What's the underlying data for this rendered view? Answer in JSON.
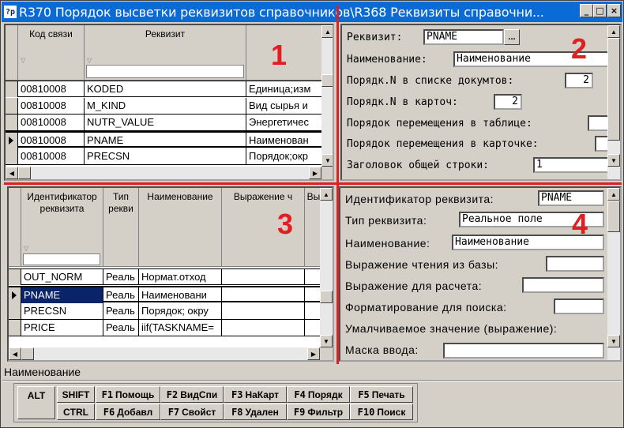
{
  "window": {
    "title": "R370 Порядок высветки реквизитов справочников\\R368 Реквизиты справочни...",
    "icon_text": "?p",
    "minimize": "_",
    "maximize": "□",
    "close": "×"
  },
  "annotations": [
    "1",
    "2",
    "3",
    "4"
  ],
  "grid1": {
    "columns": [
      "Код связи",
      "Реквизит"
    ],
    "rows": [
      {
        "code": "00810008",
        "req": "KODED",
        "desc": "Единица;изм"
      },
      {
        "code": "00810008",
        "req": "M_KIND",
        "desc": "Вид сырья и"
      },
      {
        "code": "00810008",
        "req": "NUTR_VALUE",
        "desc": "Энергетичес"
      },
      {
        "code": "00810008",
        "req": "PNAME",
        "desc": "Наименован"
      },
      {
        "code": "00810008",
        "req": "PRECSN",
        "desc": "Порядок;окр"
      }
    ]
  },
  "form2": {
    "requisite_label": "Реквизит:",
    "requisite_value": "PNAME",
    "lookup_button": "...",
    "name_label": "Наименование:",
    "name_value": "Наименование",
    "order_docs_label": "Порядк.N в списке докумтов:",
    "order_docs_value": "2",
    "order_card_label": "Порядк.N в карточ:",
    "order_card_value": "2",
    "move_table_label": "Порядок перемещения в таблице:",
    "move_card_label": "Порядок перемещения в карточке:",
    "header_label": "Заголовок общей строки:",
    "header_value": "1"
  },
  "grid3": {
    "columns": [
      "Идентификатор реквизита",
      "Тип рекви",
      "Наименование",
      "Выражение ч",
      "Вы"
    ],
    "rows": [
      {
        "id": "OUT_NORM",
        "type": "Реаль",
        "name": "Нормат.отход"
      },
      {
        "id": "PNAME",
        "type": "Реаль",
        "name": "Наименовани"
      },
      {
        "id": "PRECSN",
        "type": "Реаль",
        "name": "Порядок; окру"
      },
      {
        "id": "PRICE",
        "type": "Реаль",
        "name": "iif(TASKNAME="
      }
    ]
  },
  "form4": {
    "id_label": "Идентификатор реквизита:",
    "id_value": "PNAME",
    "type_label": "Тип реквизита:",
    "type_value": "Реальное поле",
    "name_label": "Наименование:",
    "name_value": "Наименование",
    "read_expr_label": "Выражение чтения из базы:",
    "calc_expr_label": "Выражение для расчета:",
    "search_fmt_label": "Форматирование для поиска:",
    "default_label": "Умалчиваемое значение (выражение):",
    "mask_label": "Маска ввода:"
  },
  "status": {
    "text": "Наименование"
  },
  "keys": {
    "alt": "ALT",
    "shift": "SHIFT",
    "ctrl": "CTRL",
    "f_top": [
      {
        "num": "F1",
        "label": "Помощь"
      },
      {
        "num": "F2",
        "label": "ВидСпи"
      },
      {
        "num": "F3",
        "label": "НаКарт"
      },
      {
        "num": "F4",
        "label": "Порядк"
      },
      {
        "num": "F5",
        "label": "Печать"
      }
    ],
    "f_bottom": [
      {
        "num": "F6",
        "label": "Добавл"
      },
      {
        "num": "F7",
        "label": "Свойст"
      },
      {
        "num": "F8",
        "label": "Удален"
      },
      {
        "num": "F9",
        "label": "Фильтр"
      },
      {
        "num": "F10",
        "label": "Поиск"
      }
    ]
  }
}
